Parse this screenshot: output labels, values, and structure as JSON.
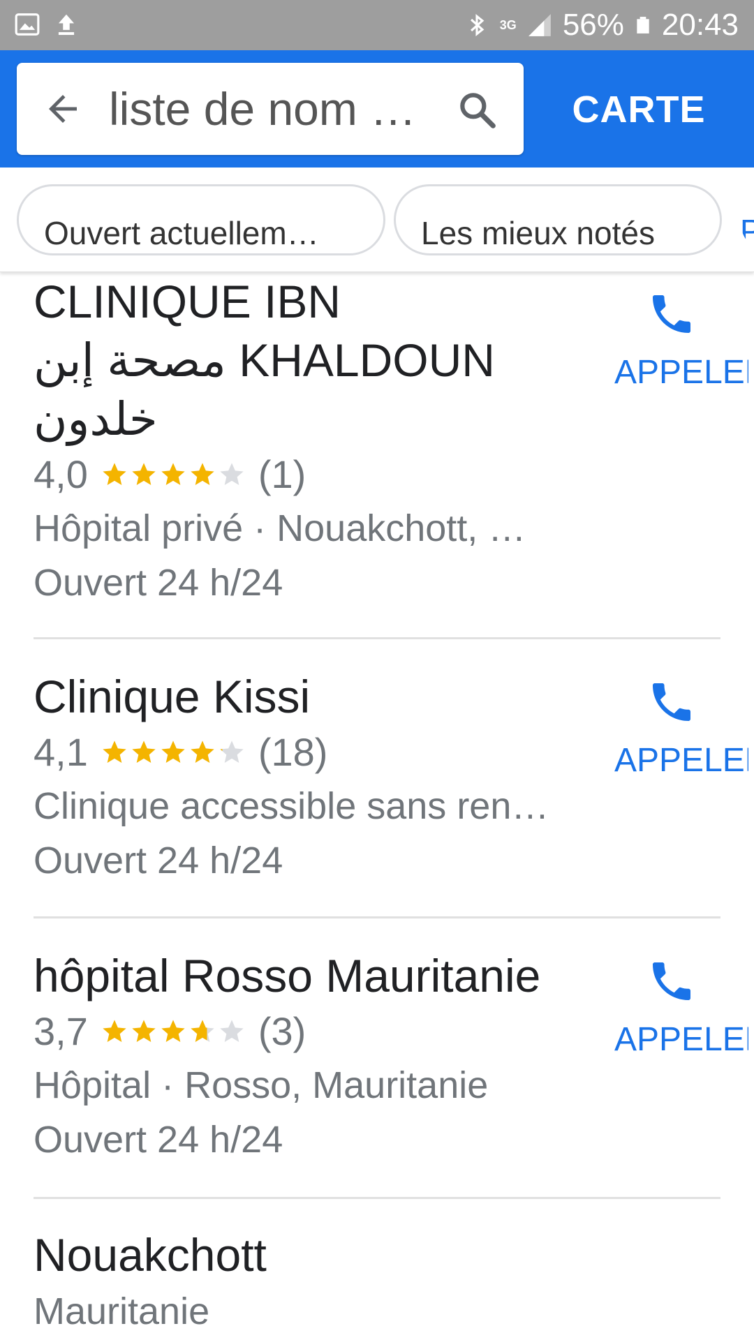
{
  "status_bar": {
    "left_icons": [
      "image-icon",
      "upload-icon"
    ],
    "bluetooth_icon": "bluetooth-icon",
    "network_type": "3G",
    "signal_icon": "signal-icon",
    "battery_percent": "56%",
    "battery_icon": "battery-icon",
    "time": "20:43"
  },
  "app_bar": {
    "back_icon": "arrow-back-icon",
    "search_query": "liste de nom …",
    "search_icon": "search-icon",
    "map_button": "CARTE",
    "color": "#1a73e8"
  },
  "filters": {
    "chips": [
      "Ouvert actuellem…",
      "Les mieux notés",
      "P"
    ]
  },
  "results": [
    {
      "title_line1": "CLINIQUE IBN",
      "title_line2": "مصحة إبن KHALDOUN",
      "title_line3": "خلدون",
      "rating": "4,0",
      "stars_value": 4.0,
      "reviews": "(1)",
      "category": "Hôpital privé · Nouakchott, …",
      "hours": "Ouvert 24 h/24",
      "call_label": "APPELER"
    },
    {
      "title": "Clinique Kissi",
      "rating": "4,1",
      "stars_value": 4.1,
      "reviews": "(18)",
      "category": "Clinique accessible sans ren…",
      "hours": "Ouvert 24 h/24",
      "call_label": "APPELER"
    },
    {
      "title": "hôpital Rosso Mauritanie",
      "rating": "3,7",
      "stars_value": 3.7,
      "reviews": "(3)",
      "category": "Hôpital · Rosso, Mauritanie",
      "hours": "Ouvert 24 h/24",
      "call_label": "APPELER"
    },
    {
      "title": "Nouakchott",
      "subtitle": "Mauritanie"
    }
  ],
  "colors": {
    "star_filled": "#f4b400",
    "star_empty": "#dadce0",
    "link_blue": "#1a73e8"
  }
}
